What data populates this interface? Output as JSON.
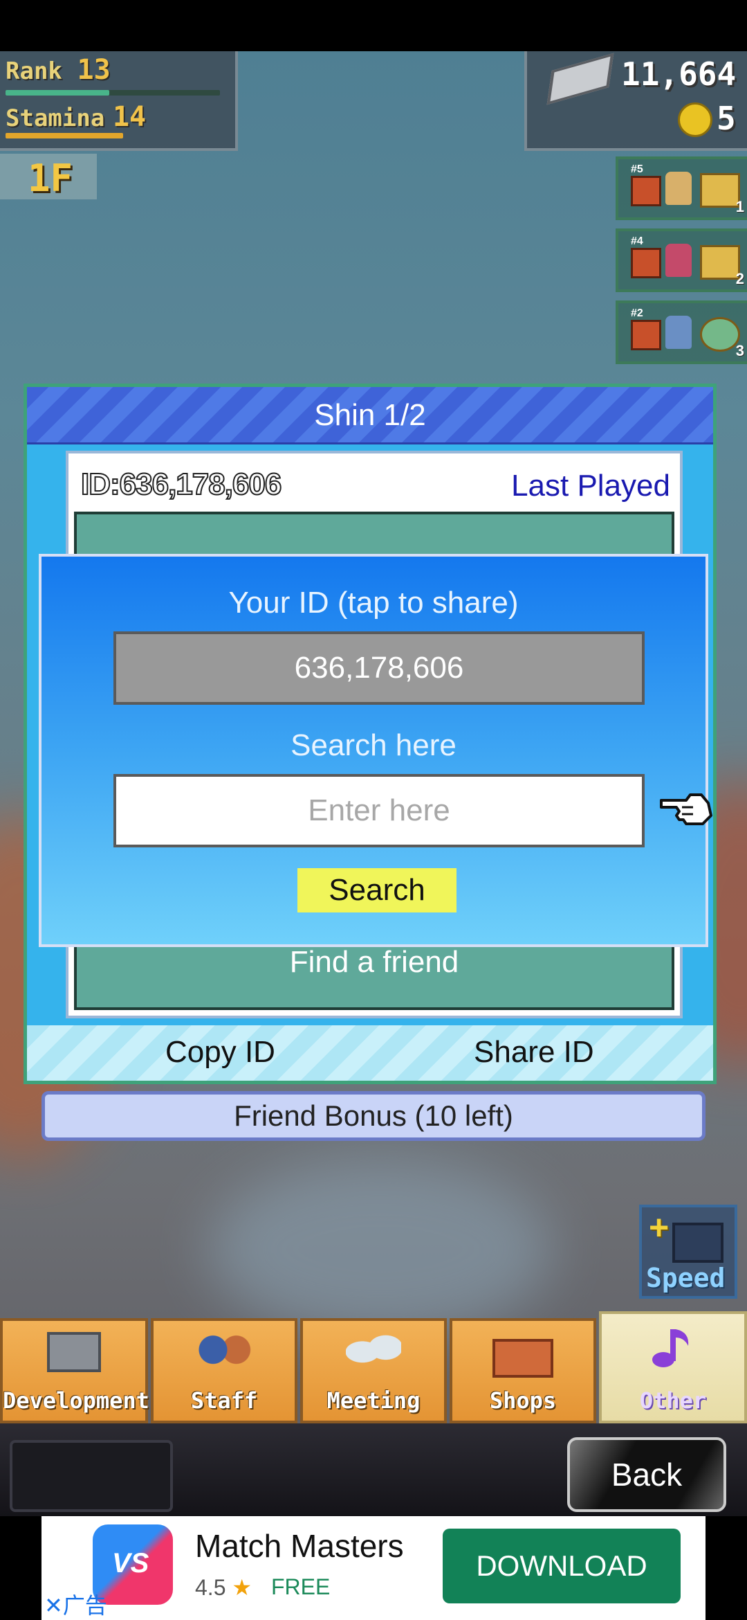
{
  "hud": {
    "rank_label": "Rank",
    "rank_value": "13",
    "stamina_label": "Stamina",
    "stamina_value": "14",
    "floor": "1F",
    "money": "11,664",
    "coins": "5"
  },
  "projects": [
    {
      "tag": "#5",
      "num": "1"
    },
    {
      "tag": "#4",
      "num": "2"
    },
    {
      "tag": "#2",
      "num": "3"
    }
  ],
  "friend_panel": {
    "title": "Shin  1/2",
    "friend_id": "ID:636,178,606",
    "last_played": "Last Played",
    "find_friend": "Find a friend",
    "copy_id": "Copy ID",
    "share_id": "Share ID"
  },
  "friend_bonus": "Friend Bonus (10 left)",
  "search_modal": {
    "your_id_label": "Your ID (tap to share)",
    "your_id_value": "636,178,606",
    "search_label": "Search here",
    "search_placeholder": "Enter here",
    "search_button": "Search"
  },
  "speed_label": "Speed",
  "bottom_menu": [
    {
      "label": "Development"
    },
    {
      "label": "Staff"
    },
    {
      "label": "Meeting"
    },
    {
      "label": "Shops"
    },
    {
      "label": "Other"
    }
  ],
  "back_button": "Back",
  "ad": {
    "app_name": "Match Masters",
    "rating": "4.5",
    "star": "★",
    "price": "FREE",
    "cta": "DOWNLOAD",
    "close": "✕广告",
    "icon_text": "VS"
  },
  "colors": {
    "modal_top": "#1478ee",
    "modal_bottom": "#6fd0fa",
    "search_button": "#f0f55a",
    "download_button": "#128257",
    "last_played": "#1a1ab0"
  }
}
